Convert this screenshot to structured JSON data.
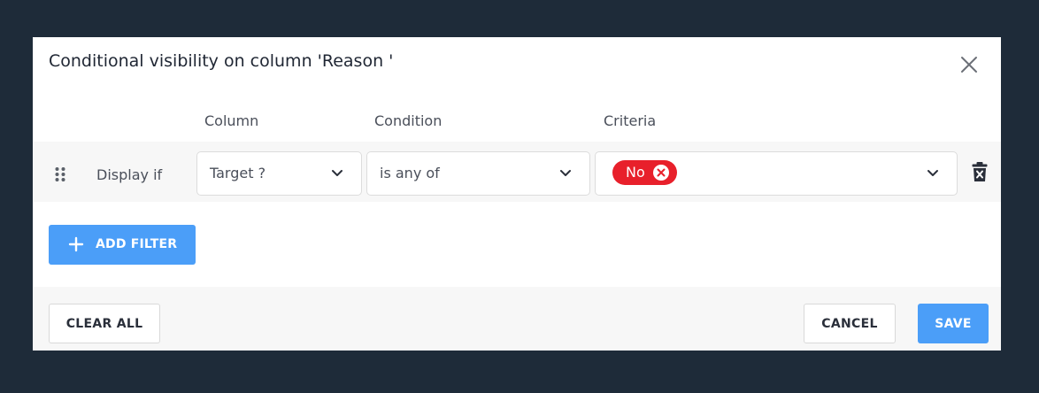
{
  "modal": {
    "title": "Conditional visibility on column 'Reason '"
  },
  "headers": {
    "column": "Column",
    "condition": "Condition",
    "criteria": "Criteria"
  },
  "filter_row": {
    "prefix": "Display if",
    "column_value": "Target ?",
    "condition_value": "is any of",
    "criteria_tags": [
      "No"
    ]
  },
  "buttons": {
    "add_filter": "ADD FILTER",
    "clear_all": "CLEAR ALL",
    "cancel": "CANCEL",
    "save": "SAVE"
  },
  "colors": {
    "backdrop": "#1e2b39",
    "primary": "#4b9ef8",
    "tag": "#e8202b"
  },
  "icons": {
    "close": "close-icon",
    "drag": "drag-handle-icon",
    "chevron": "chevron-down-icon",
    "tag_remove": "remove-tag-icon",
    "delete": "delete-trash-icon",
    "plus": "plus-icon"
  }
}
